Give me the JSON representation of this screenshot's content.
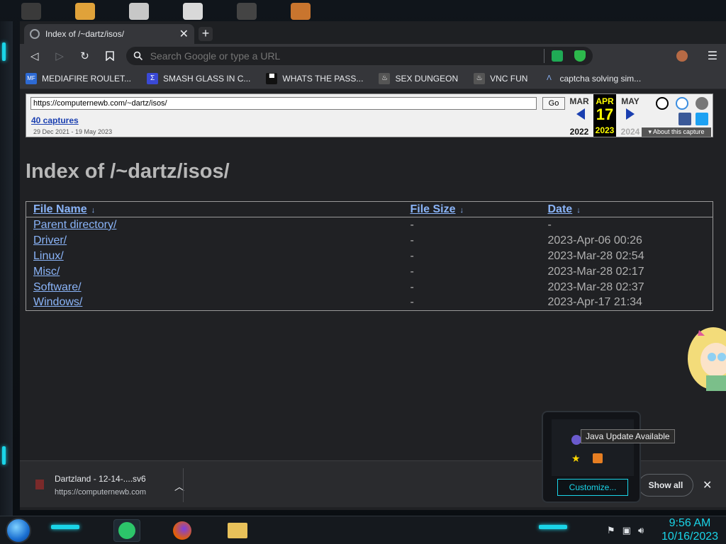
{
  "tab": {
    "title": "Index of /~dartz/isos/",
    "close": "✕",
    "new": "+"
  },
  "toolbar": {
    "search_placeholder": "Search Google or type a URL",
    "back": "◁",
    "forward": "▷",
    "reload": "↻",
    "bookmark": "⎕",
    "menu": "☰"
  },
  "bookmarks": [
    {
      "label": "MEDIAFIRE ROULET...",
      "icon": "mediafire-icon",
      "icon_text": "MF"
    },
    {
      "label": "SMASH GLASS IN C...",
      "icon": "sigma-icon",
      "icon_text": "Σ"
    },
    {
      "label": "WHATS THE PASS...",
      "icon": "printer-icon",
      "icon_text": "▀"
    },
    {
      "label": "SEX DUNGEON",
      "icon": "steam-icon",
      "icon_text": "♨"
    },
    {
      "label": "VNC FUN",
      "icon": "steam-icon",
      "icon_text": "♨"
    },
    {
      "label": "captcha solving sim...",
      "icon": "lambda-icon",
      "icon_text": "Λ"
    }
  ],
  "wayback": {
    "url": "https://computernewb.com/~dartz/isos/",
    "go": "Go",
    "captures": "40 captures",
    "range": "29 Dec 2021 - 19 May 2023",
    "prev_month": "MAR",
    "cur_month": "APR",
    "next_month": "MAY",
    "cur_day": "17",
    "prev_year": "2022",
    "cur_year": "2023",
    "next_year": "2024",
    "about": "▾ About this capture"
  },
  "page": {
    "title": "Index of /~dartz/isos/",
    "columns": [
      "File Name",
      "File Size",
      "Date"
    ],
    "sort_arrow": "↓",
    "rows": [
      {
        "name": "Parent directory/",
        "size": "-",
        "date": "-"
      },
      {
        "name": "Driver/",
        "size": "-",
        "date": "2023-Apr-06 00:26"
      },
      {
        "name": "Linux/",
        "size": "-",
        "date": "2023-Mar-28 02:54"
      },
      {
        "name": "Misc/",
        "size": "-",
        "date": "2023-Mar-28 02:17"
      },
      {
        "name": "Software/",
        "size": "-",
        "date": "2023-Mar-28 02:37"
      },
      {
        "name": "Windows/",
        "size": "-",
        "date": "2023-Apr-17 21:34"
      }
    ]
  },
  "downloads": {
    "file": "Dartzland - 12-14-....sv6",
    "source": "https://computernewb.com",
    "show_all": "Show all",
    "close": "✕"
  },
  "tray": {
    "tooltip": "Java Update Available",
    "customize": "Customize..."
  },
  "clock": {
    "time": "9:56 AM",
    "date": "10/16/2023"
  },
  "colors": {
    "accent": "#1ad5e8",
    "link": "#8ab4f8",
    "page_bg": "#202124"
  }
}
